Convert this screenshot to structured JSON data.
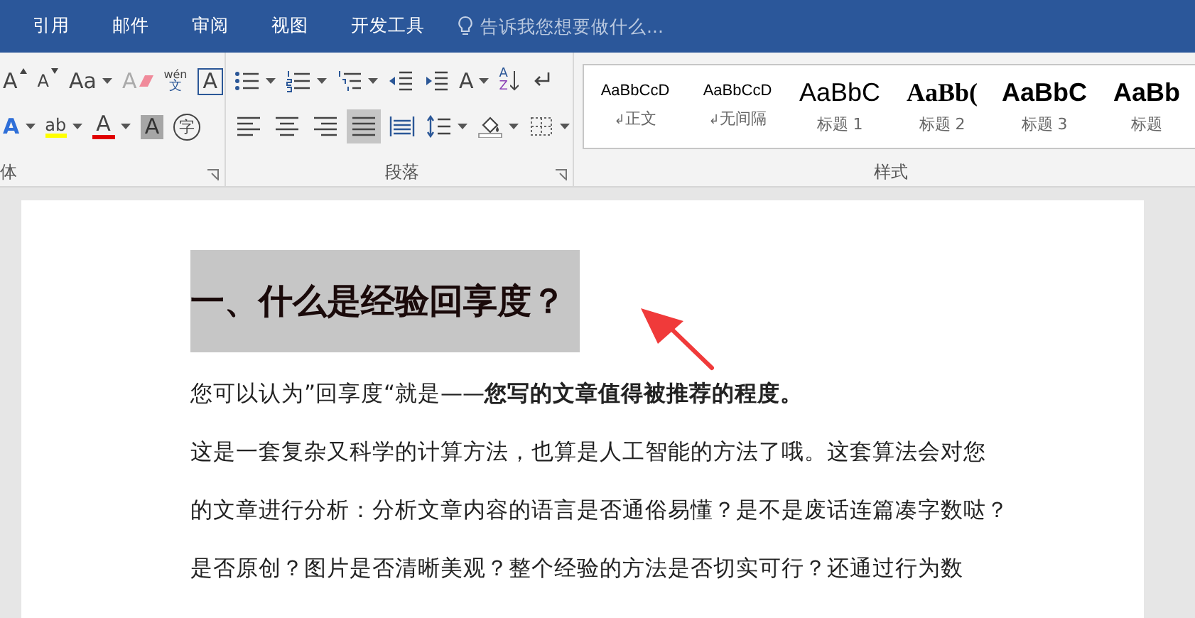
{
  "tabs": [
    {
      "label": "引用"
    },
    {
      "label": "邮件"
    },
    {
      "label": "审阅"
    },
    {
      "label": "视图"
    },
    {
      "label": "开发工具"
    }
  ],
  "tell_me": {
    "placeholder": "告诉我您想要做什么..."
  },
  "font_group": {
    "label": "体",
    "row1": [
      {
        "kind": "grow",
        "text": "A"
      },
      {
        "kind": "shrink",
        "text": "A"
      },
      {
        "kind": "case",
        "text": "Aa",
        "dropdown": true
      },
      {
        "kind": "clear",
        "text": "A"
      },
      {
        "kind": "phonetic",
        "text": "wén",
        "sub": "文"
      },
      {
        "kind": "border",
        "text": "A"
      }
    ],
    "row2": [
      {
        "kind": "effects",
        "text": "A",
        "dropdown": true
      },
      {
        "kind": "highlight",
        "text": "ab",
        "dropdown": true
      },
      {
        "kind": "color",
        "text": "A",
        "dropdown": true
      },
      {
        "kind": "shading",
        "text": "A"
      },
      {
        "kind": "enclose",
        "text": "字"
      }
    ]
  },
  "paragraph_group": {
    "label": "段落",
    "row1": [
      {
        "kind": "bullets",
        "dropdown": true
      },
      {
        "kind": "numbering",
        "dropdown": true
      },
      {
        "kind": "multilevel",
        "dropdown": true
      },
      {
        "kind": "outdent"
      },
      {
        "kind": "indent"
      },
      {
        "kind": "asian",
        "text": "A",
        "dropdown": true
      },
      {
        "kind": "sort",
        "text": "A",
        "sub": "Z"
      },
      {
        "kind": "marks"
      }
    ],
    "alignment": [
      {
        "kind": "left",
        "selected": false
      },
      {
        "kind": "center",
        "selected": false
      },
      {
        "kind": "right",
        "selected": false
      },
      {
        "kind": "justify",
        "selected": true
      },
      {
        "kind": "distributed",
        "selected": false
      }
    ],
    "row2": [
      {
        "kind": "spacing",
        "dropdown": true
      },
      {
        "kind": "fill",
        "dropdown": true
      },
      {
        "kind": "borders",
        "dropdown": true
      }
    ]
  },
  "styles_group": {
    "label": "样式",
    "styles": [
      {
        "kind": "body",
        "sample": "AaBbCcD",
        "mark": "↲",
        "name": "正文"
      },
      {
        "kind": "nospacing",
        "sample": "AaBbCcD",
        "mark": "↲",
        "name": "无间隔"
      },
      {
        "kind": "h1",
        "sample": "AaBbC",
        "name": "标题 1"
      },
      {
        "kind": "h2",
        "sample": "AaBb(",
        "name": "标题 2"
      },
      {
        "kind": "h3",
        "sample": "AaBbC",
        "name": "标题 3"
      },
      {
        "kind": "h4",
        "sample": "AaBb",
        "name": "标题"
      }
    ]
  },
  "document": {
    "heading": {
      "text": "一、什么是经验回享度？",
      "highlighted": true
    },
    "paragraphs": [
      {
        "lines": [
          "您可以认为”回享度“就是——**您写的文章值得被推荐的程度。**"
        ]
      },
      {
        "lines": [
          "这是一套复杂又科学的计算方法，也算是人工智能的方法了哦。这套算法会对您",
          "的文章进行分析：分析文章内容的语言是否通俗易懂？是不是废话连篇凑字数哒？",
          "是否原创？图片是否清晰美观？整个经验的方法是否切实可行？还通过行为数"
        ]
      }
    ]
  }
}
